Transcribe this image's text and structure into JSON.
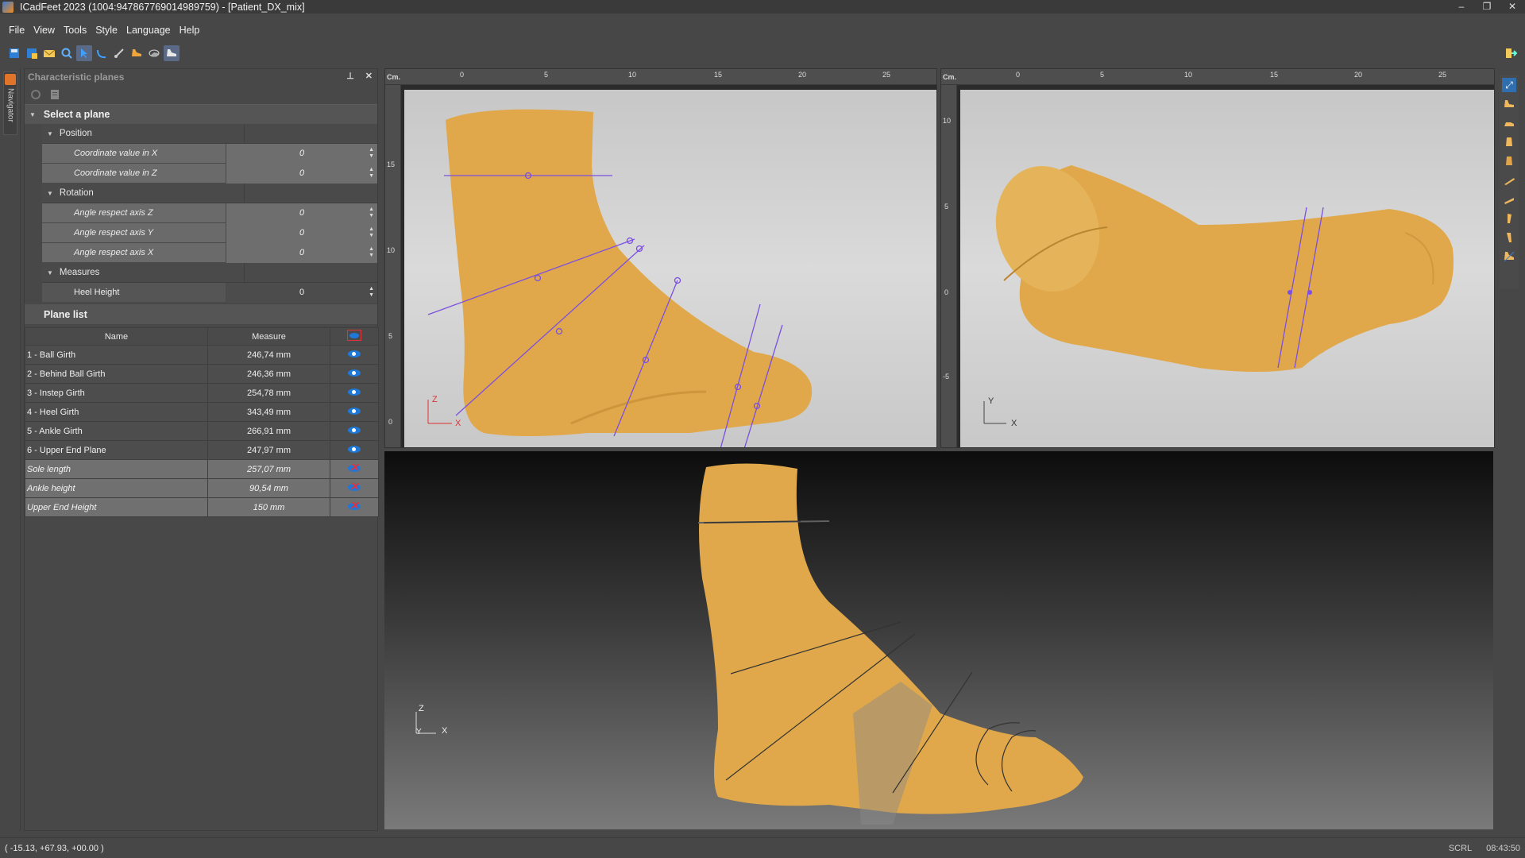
{
  "window": {
    "title": "ICadFeet 2023 (1004:947867769014989759) -  [Patient_DX_mix]",
    "controls": [
      "–",
      "❐",
      "✕"
    ]
  },
  "menu": [
    "File",
    "View",
    "Tools",
    "Style",
    "Language",
    "Help"
  ],
  "navigator_tab": "Navigator",
  "panel": {
    "title": "Characteristic planes",
    "pin_glyph": "⊥",
    "close_glyph": "✕",
    "select_plane": "Select a plane",
    "position_group": "Position",
    "coord_x_label": "Coordinate value in X",
    "coord_x_value": "0",
    "coord_z_label": "Coordinate value in Z",
    "coord_z_value": "0",
    "rotation_group": "Rotation",
    "angle_z_label": "Angle respect axis Z",
    "angle_z_value": "0",
    "angle_y_label": "Angle respect axis Y",
    "angle_y_value": "0",
    "angle_x_label": "Angle respect axis X",
    "angle_x_value": "0",
    "measures_group": "Measures",
    "heel_height_label": "Heel Height",
    "heel_height_value": "0",
    "plane_list_title": "Plane list",
    "col_name": "Name",
    "col_measure": "Measure"
  },
  "planes": [
    {
      "name": "1 - Ball Girth",
      "measure": "246,74 mm"
    },
    {
      "name": "2 - Behind Ball Girth",
      "measure": "246,36 mm"
    },
    {
      "name": "3 - Instep Girth",
      "measure": "254,78 mm"
    },
    {
      "name": "4 - Heel Girth",
      "measure": "343,49 mm"
    },
    {
      "name": "5 - Ankle Girth",
      "measure": "266,91 mm"
    },
    {
      "name": "6 - Upper End Plane",
      "measure": "247,97 mm"
    }
  ],
  "reference_measures": [
    {
      "name": "Sole length",
      "measure": "257,07 mm"
    },
    {
      "name": "Ankle height",
      "measure": "90,54 mm"
    },
    {
      "name": "Upper End Height",
      "measure": "150 mm"
    }
  ],
  "viewports": {
    "cm_label": "Cm.",
    "side_x_ticks": [
      "0",
      "5",
      "10",
      "15",
      "20",
      "25"
    ],
    "side_y_ticks": [
      "15",
      "10",
      "5",
      "0"
    ],
    "top_x_ticks": [
      "0",
      "5",
      "10",
      "15",
      "20",
      "25"
    ],
    "top_y_ticks": [
      "10",
      "5",
      "0",
      "-5"
    ],
    "side_axes": {
      "a": "Z",
      "b": "X"
    },
    "top_axes": {
      "a": "Y",
      "b": "X"
    },
    "view3d_axes": {
      "a": "Z",
      "b": "Y",
      "c": "X"
    }
  },
  "colors": {
    "foot": "#e0a84a",
    "plane_line": "#7b4fe0",
    "eye_blue": "#1e78d8",
    "hidden_red": "#e2333a"
  },
  "status": {
    "coords": "( -15.13, +67.93, +00.00 )",
    "scrl": "SCRL",
    "time": "08:43:50"
  }
}
